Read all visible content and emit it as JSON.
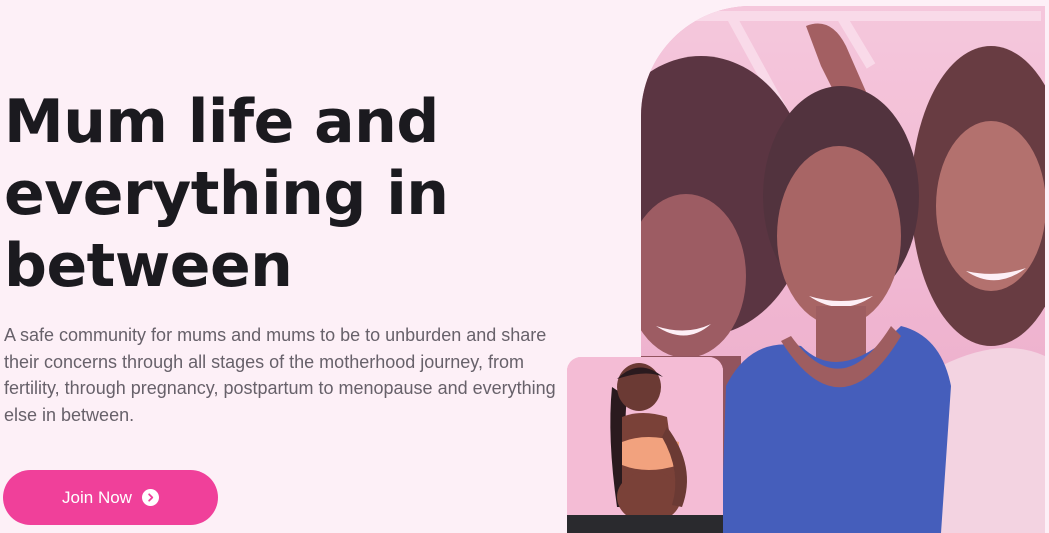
{
  "hero": {
    "headline_line1": "Mum life and",
    "headline_line2": "everything in",
    "headline_line3": "between",
    "subtext": "A safe community for mums and mums to be to unburden and share their concerns through all stages of the motherhood journey, from fertility, through pregnancy, postpartum to menopause and everything else in between.",
    "join_label": "Join Now"
  },
  "images": {
    "main_photo": "group-of-smiling-women-photo",
    "small_photo": "pregnant-woman-photo"
  },
  "colors": {
    "background": "#fdf0f7",
    "accent": "#f0409a",
    "headline": "#1b1a1f",
    "body_text": "#67616a"
  }
}
